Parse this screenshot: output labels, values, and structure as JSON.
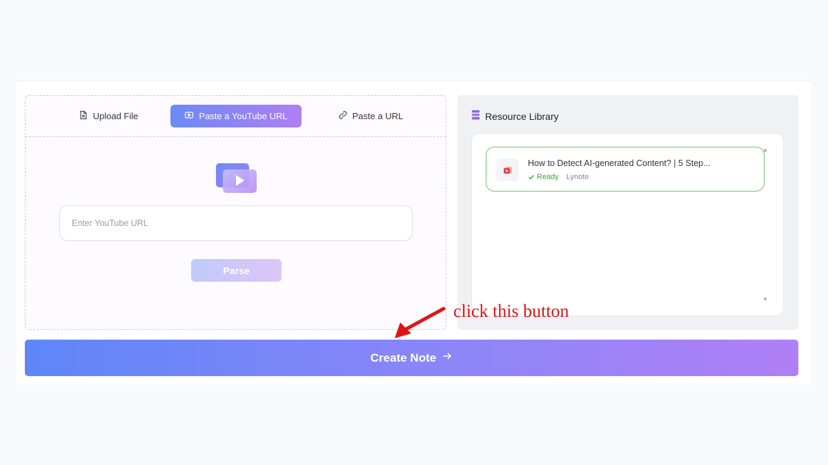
{
  "tabs": {
    "upload_label": "Upload File",
    "youtube_label": "Paste a YouTube URL",
    "url_label": "Paste a URL"
  },
  "youtube": {
    "placeholder": "Enter YouTube URL",
    "parse_label": "Parse"
  },
  "library": {
    "title": "Resource Library",
    "items": [
      {
        "title": "How to Detect AI-generated Content? | 5 Step...",
        "status": "Ready",
        "source": "Lynote",
        "status_color": "#3aa844"
      }
    ]
  },
  "create_note": {
    "label": "Create Note"
  },
  "annotation": {
    "text": "click this button",
    "color": "#e01414"
  },
  "colors": {
    "accent_start": "#5e86f7",
    "accent_end": "#b07ff5",
    "ready_border": "#6cc46a"
  }
}
